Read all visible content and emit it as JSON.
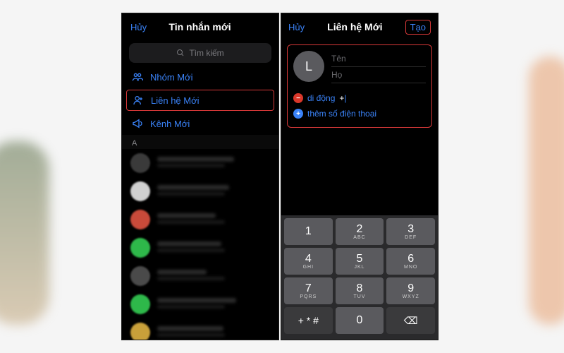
{
  "left": {
    "cancel": "Hủy",
    "title": "Tin nhắn mới",
    "search_placeholder": "Tìm kiếm",
    "options": [
      {
        "label": "Nhóm Mới"
      },
      {
        "label": "Liên hệ Mới"
      },
      {
        "label": "Kênh Mới"
      }
    ],
    "section": "A",
    "contacts": [
      {
        "color": "#3a3a3a"
      },
      {
        "color": "#d0d0d0"
      },
      {
        "color": "#c94a3a"
      },
      {
        "color": "#2eb84a"
      },
      {
        "color": "#4a4a4a"
      },
      {
        "color": "#2eb84a"
      },
      {
        "color": "#c9a03a"
      }
    ]
  },
  "right": {
    "cancel": "Hủy",
    "title": "Liên hệ Mới",
    "create": "Tạo",
    "avatar_letter": "L",
    "firstname_ph": "Tên",
    "lastname_ph": "Họ",
    "mobile_label": "di động",
    "mobile_value": "+",
    "add_phone": "thêm số điện thoại"
  },
  "keypad": [
    [
      {
        "n": "1",
        "l": ""
      },
      {
        "n": "2",
        "l": "ABC"
      },
      {
        "n": "3",
        "l": "DEF"
      }
    ],
    [
      {
        "n": "4",
        "l": "GHI"
      },
      {
        "n": "5",
        "l": "JKL"
      },
      {
        "n": "6",
        "l": "MNO"
      }
    ],
    [
      {
        "n": "7",
        "l": "PQRS"
      },
      {
        "n": "8",
        "l": "TUV"
      },
      {
        "n": "9",
        "l": "WXYZ"
      }
    ],
    [
      {
        "n": "+ * #",
        "l": "",
        "dark": true
      },
      {
        "n": "0",
        "l": ""
      },
      {
        "n": "⌫",
        "l": "",
        "dark": true
      }
    ]
  ]
}
